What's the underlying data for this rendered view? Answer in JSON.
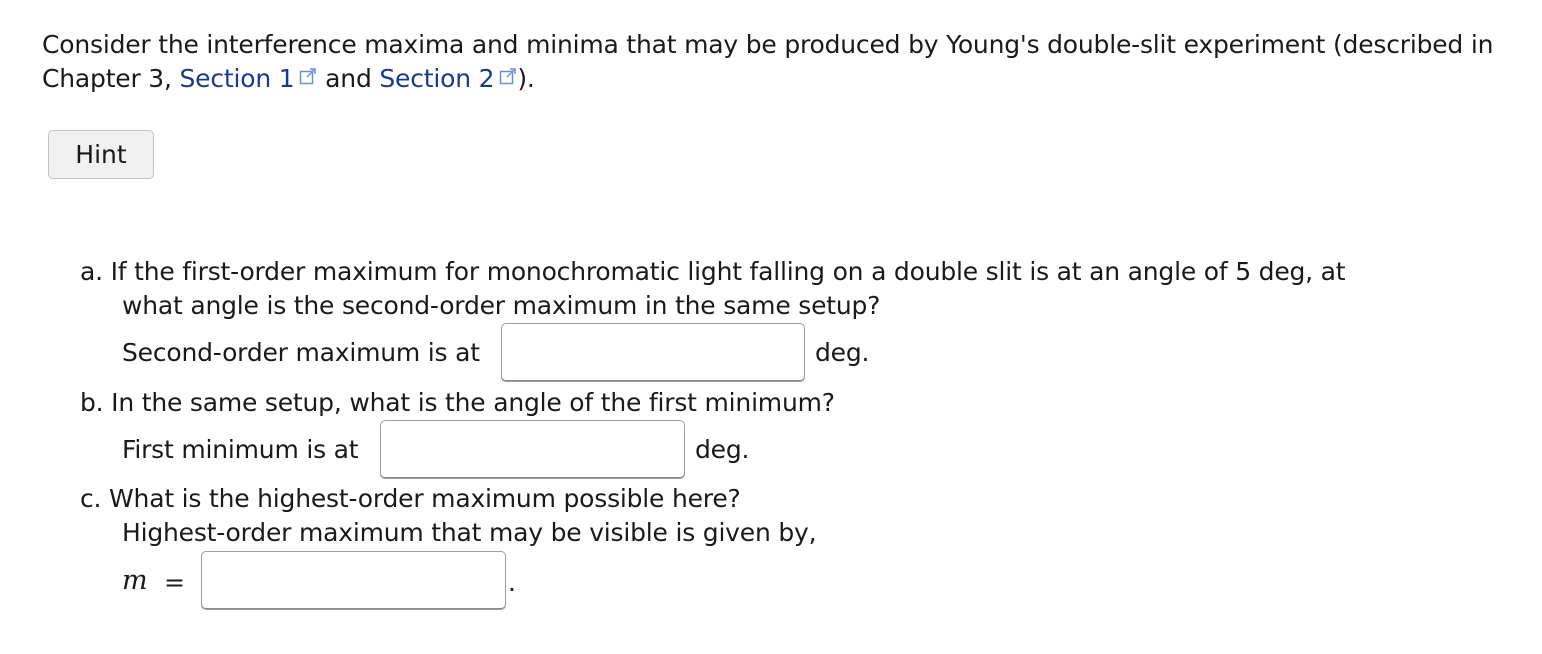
{
  "intro": {
    "text_before": "Consider the interference maxima and minima that may be produced by Young's double-slit experiment (described in Chapter 3, ",
    "link1": "Section 1",
    "text_between": " and ",
    "link2": "Section 2",
    "text_after": ")."
  },
  "hint_button": "Hint",
  "part_a": {
    "line1": "a. If the first-order maximum for monochromatic light falling on a double slit is at an angle of 5 deg, at",
    "line2": "what angle is the second-order maximum in the same setup?",
    "answer_label": "Second-order maximum is at",
    "unit": "deg.",
    "value": ""
  },
  "part_b": {
    "question": "b. In the same setup, what is the angle of the first minimum?",
    "answer_label": "First minimum is at",
    "unit": "deg.",
    "value": ""
  },
  "part_c": {
    "line1": "c. What is the highest-order maximum possible here?",
    "line2": "Highest-order maximum that may be visible is given by,",
    "var": "m",
    "eq": "=",
    "end": ".",
    "value": ""
  },
  "colors": {
    "link": "#1a3a8a",
    "text": "#1a1a1a",
    "hint_bg": "#f1f1f1"
  },
  "icons": {
    "external_link": "external-link-icon"
  }
}
